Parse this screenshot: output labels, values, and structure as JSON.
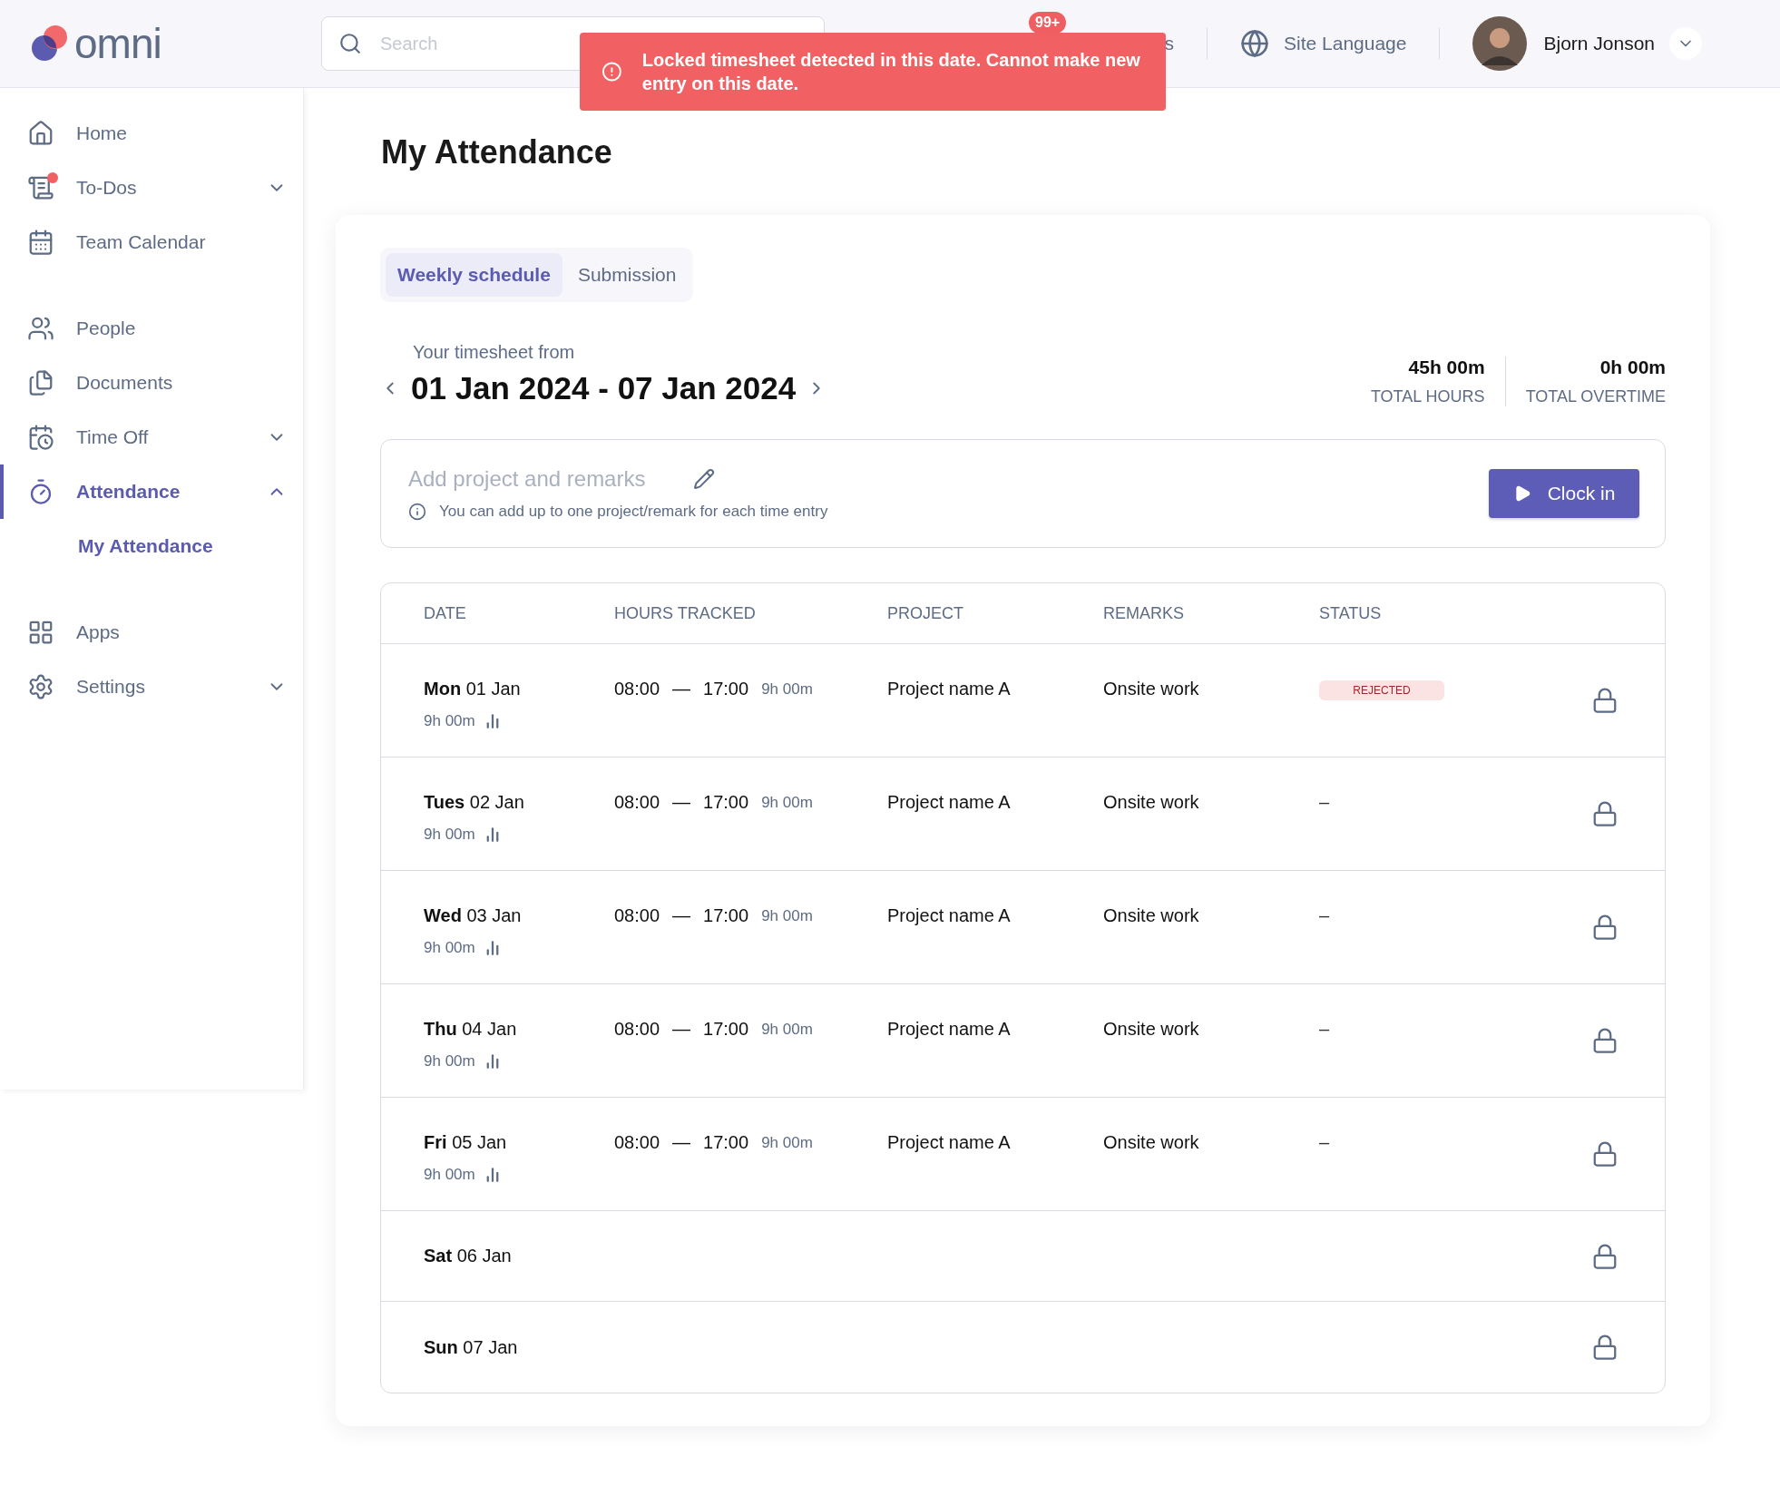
{
  "header": {
    "logo": "omni",
    "search_placeholder": "Search",
    "notification_badge": "99+",
    "hidden_nav_label": "s",
    "language": "Site Language",
    "user_name": "Bjorn Jonson"
  },
  "toast": {
    "message": "Locked timesheet detected in this date. Cannot make new entry on this date."
  },
  "sidebar": {
    "items": [
      {
        "label": "Home",
        "dot": false,
        "selected": false
      },
      {
        "label": "To-Dos",
        "dot": true,
        "expanded": false,
        "selected": false
      },
      {
        "label": "Team Calendar",
        "dot": false,
        "selected": false
      },
      {
        "label": "People",
        "dot": false,
        "selected": false
      },
      {
        "label": "Documents",
        "dot": false,
        "selected": false
      },
      {
        "label": "Time Off",
        "dot": false,
        "expanded": false,
        "selected": false
      },
      {
        "label": "Attendance",
        "dot": false,
        "expanded": true,
        "selected": true,
        "children": [
          {
            "label": "My Attendance",
            "selected": true
          }
        ]
      },
      {
        "label": "Apps",
        "dot": false,
        "selected": false
      },
      {
        "label": "Settings",
        "dot": false,
        "expanded": false,
        "selected": false
      }
    ]
  },
  "page_title": "My Attendance",
  "tabs": [
    {
      "label": "Weekly schedule",
      "selected": true
    },
    {
      "label": "Submission",
      "selected": false
    }
  ],
  "timesheet": {
    "caption": "Your timesheet from",
    "range": "01 Jan 2024 - 07 Jan 2024"
  },
  "stats": [
    {
      "value": "45h 00m",
      "label": "TOTAL HOURS"
    },
    {
      "value": "0h 00m",
      "label": "TOTAL OVERTIME"
    }
  ],
  "entry": {
    "placeholder": "Add project and remarks",
    "hint": "You can add up to one project/remark for each time entry",
    "button": "Clock in"
  },
  "table": {
    "columns": [
      "DATE",
      "HOURS TRACKED",
      "PROJECT",
      "REMARKS",
      "STATUS"
    ],
    "rows": [
      {
        "day": "Mon",
        "date": "01 Jan",
        "total": "9h 00m",
        "start": "08:00",
        "sep": "—",
        "end": "17:00",
        "duration": "9h 00m",
        "project": "Project name A",
        "remarks": "Onsite work",
        "status": {
          "kind": "rejected",
          "label": "REJECTED"
        },
        "locked": true
      },
      {
        "day": "Tues",
        "date": "02 Jan",
        "total": "9h 00m",
        "start": "08:00",
        "sep": "—",
        "end": "17:00",
        "duration": "9h 00m",
        "project": "Project name A",
        "remarks": "Onsite work",
        "status": {
          "kind": "none",
          "label": "–"
        },
        "locked": true
      },
      {
        "day": "Wed",
        "date": "03 Jan",
        "total": "9h 00m",
        "start": "08:00",
        "sep": "—",
        "end": "17:00",
        "duration": "9h 00m",
        "project": "Project name A",
        "remarks": "Onsite work",
        "status": {
          "kind": "none",
          "label": "–"
        },
        "locked": true
      },
      {
        "day": "Thu",
        "date": "04 Jan",
        "total": "9h 00m",
        "start": "08:00",
        "sep": "—",
        "end": "17:00",
        "duration": "9h 00m",
        "project": "Project name A",
        "remarks": "Onsite work",
        "status": {
          "kind": "none",
          "label": "–"
        },
        "locked": true
      },
      {
        "day": "Fri",
        "date": "05 Jan",
        "total": "9h 00m",
        "start": "08:00",
        "sep": "—",
        "end": "17:00",
        "duration": "9h 00m",
        "project": "Project name A",
        "remarks": "Onsite work",
        "status": {
          "kind": "none",
          "label": "–"
        },
        "locked": true
      },
      {
        "day": "Sat",
        "date": "06 Jan",
        "locked": true
      },
      {
        "day": "Sun",
        "date": "07 Jan",
        "locked": true
      }
    ]
  }
}
